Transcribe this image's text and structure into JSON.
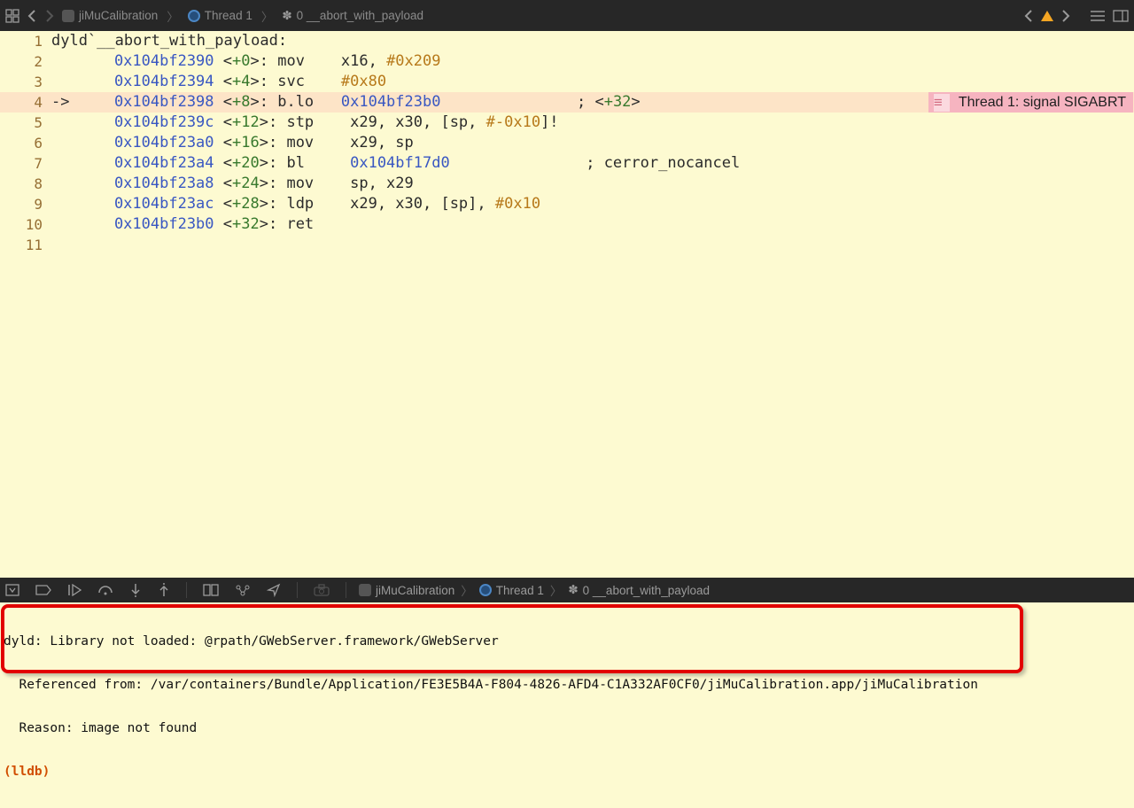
{
  "nav": {
    "crumbs": [
      {
        "icon": "app",
        "label": "jiMuCalibration"
      },
      {
        "icon": "thread",
        "label": "Thread 1"
      },
      {
        "icon": "frame",
        "label": "0 __abort_with_payload"
      }
    ]
  },
  "error_badge": "Thread 1: signal SIGABRT",
  "asm": {
    "header": "dyld`__abort_with_payload:",
    "current_idx": 2,
    "lines": [
      {
        "n": 1,
        "kind": "header"
      },
      {
        "n": 2,
        "addr": "0x104bf2390",
        "off": "+0",
        "mn": "mov",
        "ops": "x16, ",
        "imm": "#0x209"
      },
      {
        "n": 3,
        "addr": "0x104bf2394",
        "off": "+4",
        "mn": "svc",
        "ops": "",
        "imm": "#0x80"
      },
      {
        "n": 4,
        "addr": "0x104bf2398",
        "off": "+8",
        "mn": "b.lo",
        "target": "0x104bf23b0",
        "cm": "; <",
        "cmoff": "+32",
        "cm2": ">"
      },
      {
        "n": 5,
        "addr": "0x104bf239c",
        "off": "+12",
        "mn": "stp",
        "ops": "x29, x30, [sp, ",
        "imm": "#-0x10",
        "tail": "]!"
      },
      {
        "n": 6,
        "addr": "0x104bf23a0",
        "off": "+16",
        "mn": "mov",
        "ops": "x29, sp"
      },
      {
        "n": 7,
        "addr": "0x104bf23a4",
        "off": "+20",
        "mn": "bl",
        "target": "0x104bf17d0",
        "cm": "; cerror_nocancel"
      },
      {
        "n": 8,
        "addr": "0x104bf23a8",
        "off": "+24",
        "mn": "mov",
        "ops": "sp, x29"
      },
      {
        "n": 9,
        "addr": "0x104bf23ac",
        "off": "+28",
        "mn": "ldp",
        "ops": "x29, x30, [sp], ",
        "imm": "#0x10"
      },
      {
        "n": 10,
        "addr": "0x104bf23b0",
        "off": "+32",
        "mn": "ret"
      },
      {
        "n": 11
      }
    ]
  },
  "dbgbar": {
    "crumbs": [
      {
        "icon": "app",
        "label": "jiMuCalibration"
      },
      {
        "icon": "thread",
        "label": "Thread 1"
      },
      {
        "icon": "frame",
        "label": "0 __abort_with_payload"
      }
    ]
  },
  "console": {
    "l1": "dyld: Library not loaded: @rpath/GWebServer.framework/GWebServer",
    "l2": "  Referenced from: /var/containers/Bundle/Application/FE3E5B4A-F804-4826-AFD4-C1A332AF0CF0/jiMuCalibration.app/jiMuCalibration",
    "l3": "  Reason: image not found",
    "prompt": "(lldb) "
  }
}
